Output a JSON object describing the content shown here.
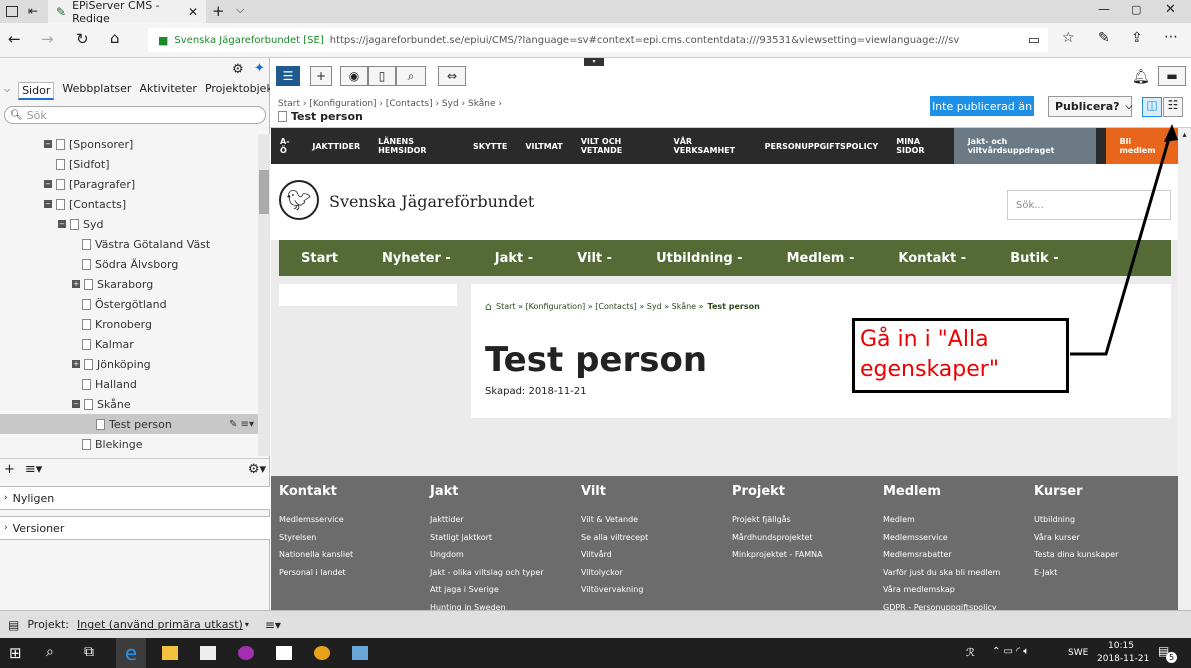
{
  "browser": {
    "tab_title": "EPiServer CMS - Redige",
    "site_name": "Svenska Jägareforbundet [SE]",
    "url": "https://jagareforbundet.se/epiui/CMS/?language=sv#context=epi.cms.contentdata:///93531&viewsetting=viewlanguage:///sv"
  },
  "left": {
    "tabs": [
      "Sidor",
      "Webbplatser",
      "Aktiviteter",
      "Projektobjekt"
    ],
    "search_placeholder": "Sök",
    "tree": [
      "[Sponsorer]",
      "[Sidfot]",
      "[Paragrafer]",
      "[Contacts]",
      "Syd",
      "Västra Götaland Väst",
      "Södra Älvsborg",
      "Skaraborg",
      "Östergötland",
      "Kronoberg",
      "Kalmar",
      "Jönköping",
      "Halland",
      "Skåne",
      "Test person",
      "Blekinge"
    ],
    "nyligen": "Nyligen",
    "versioner": "Versioner"
  },
  "cms": {
    "breadcrumb": "Start › [Konfiguration] › [Contacts] › Syd › Skåne ›",
    "page_name": "Test person",
    "status": "Inte publicerad än",
    "publish": "Publicera?"
  },
  "site": {
    "topnav": [
      "A-Ö",
      "JAKTTIDER",
      "LÄNENS HEMSIDOR",
      "SKYTTE",
      "VILTMAT",
      "VILT OCH VETANDE",
      "VÅR VERKSAMHET",
      "PERSONUPPGIFTSPOLICY",
      "MINA SIDOR"
    ],
    "topnav_assignment": "Jakt- och viltvårdsuppdraget",
    "topnav_member": "Bli medlem",
    "logo": "Svenska Jägareförbundet",
    "search_placeholder": "Sök...",
    "mainnav": [
      "Start",
      "Nyheter -",
      "Jakt -",
      "Vilt -",
      "Utbildning -",
      "Medlem -",
      "Kontakt -",
      "Butik -"
    ],
    "breadcrumb": "Start » [Konfiguration] » [Contacts] » Syd » Skåne »",
    "breadcrumb_current": "Test person",
    "title": "Test person",
    "created": "Skapad: 2018-11-21",
    "footer": [
      {
        "h": "Kontakt",
        "l": [
          "Medlemsservice",
          "Styrelsen",
          "Nationella kansliet",
          "Personal i landet"
        ]
      },
      {
        "h": "Jakt",
        "l": [
          "Jakttider",
          "Statligt jaktkort",
          "Ungdom",
          "Jakt - olika viltslag och typer",
          "Att jaga i Sverige",
          "Hunting in Sweden"
        ]
      },
      {
        "h": "Vilt",
        "l": [
          "Vilt & Vetande",
          "Se alla viltrecept",
          "Viltvård",
          "Viltolyckor",
          "Viltövervakning"
        ]
      },
      {
        "h": "Projekt",
        "l": [
          "Projekt fjällgås",
          "Mårdhundsprojektet",
          "Minkprojektet - FAMNA"
        ]
      },
      {
        "h": "Medlem",
        "l": [
          "Medlem",
          "Medlemsservice",
          "Medlemsrabatter",
          "Varför just du ska bli medlem",
          "Våra medlemskap",
          "GDPR - Personuppgiftspolicy"
        ]
      },
      {
        "h": "Kurser",
        "l": [
          "Utbildning",
          "Våra kurser",
          "Testa dina kunskaper",
          "E-Jakt"
        ]
      }
    ]
  },
  "callout": "Gå in i \"Alla egenskaper\"",
  "bottom": {
    "label": "Projekt:",
    "value": "Inget (använd primära utkast)"
  },
  "taskbar": {
    "lang": "SWE",
    "time": "10:15",
    "date": "2018-11-21",
    "badge": "5"
  }
}
